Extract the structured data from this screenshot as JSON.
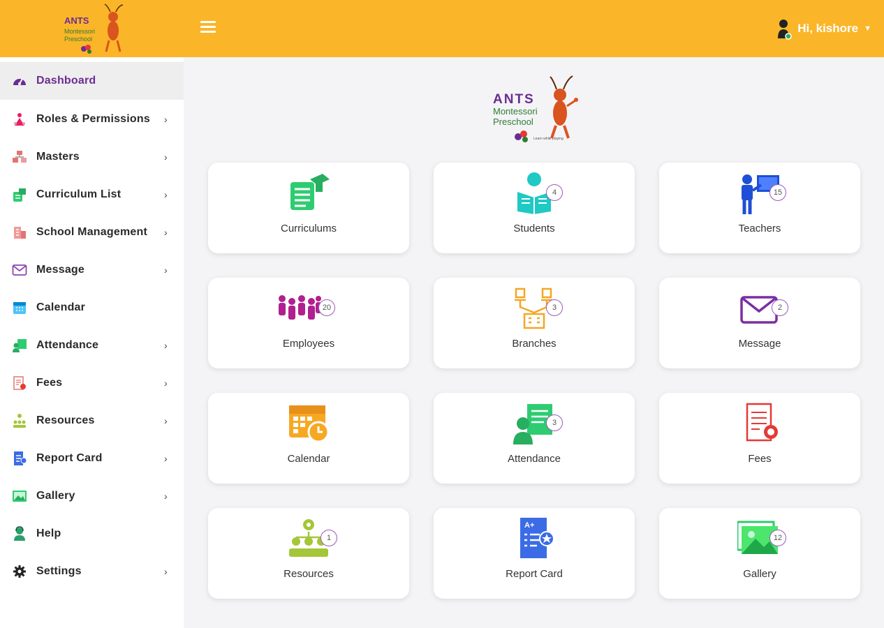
{
  "header": {
    "logo_text": {
      "line1": "ANTS",
      "line2": "Montessori",
      "line3": "Preschool",
      "tagline": "Learn while playing"
    },
    "menu_icon": "hamburger-icon",
    "user": {
      "greeting": "Hi, kishore",
      "icon": "user-icon",
      "caret": "▼"
    }
  },
  "colors": {
    "header": "#fbb528",
    "active_text": "#6a2d91",
    "badge_border": "#9b59b6"
  },
  "sidebar": {
    "items": [
      {
        "label": "Dashboard",
        "icon": "dashboard-icon",
        "chevron": ""
      },
      {
        "label": "Roles & Permissions",
        "icon": "roles-icon",
        "chevron": "›"
      },
      {
        "label": "Masters",
        "icon": "masters-icon",
        "chevron": "›"
      },
      {
        "label": "Curriculum List",
        "icon": "curriculum-icon",
        "chevron": "›"
      },
      {
        "label": "School Management",
        "icon": "school-icon",
        "chevron": "›"
      },
      {
        "label": "Message",
        "icon": "envelope-icon",
        "chevron": "›"
      },
      {
        "label": "Calendar",
        "icon": "calendar-icon",
        "chevron": ""
      },
      {
        "label": "Attendance",
        "icon": "attendance-icon",
        "chevron": "›"
      },
      {
        "label": "Fees",
        "icon": "fees-icon",
        "chevron": "›"
      },
      {
        "label": "Resources",
        "icon": "resources-icon",
        "chevron": "›"
      },
      {
        "label": "Report Card",
        "icon": "report-card-icon",
        "chevron": "›"
      },
      {
        "label": "Gallery",
        "icon": "gallery-icon",
        "chevron": "›"
      },
      {
        "label": "Help",
        "icon": "help-icon",
        "chevron": ""
      },
      {
        "label": "Settings",
        "icon": "gear-icon",
        "chevron": "›"
      }
    ]
  },
  "cards": [
    {
      "title": "Curriculums",
      "count": "",
      "icon": "curriculum-icon"
    },
    {
      "title": "Students",
      "count": "4",
      "icon": "student-icon"
    },
    {
      "title": "Teachers",
      "count": "15",
      "icon": "teacher-icon"
    },
    {
      "title": "Employees",
      "count": "20",
      "icon": "employees-icon"
    },
    {
      "title": "Branches",
      "count": "3",
      "icon": "branches-icon"
    },
    {
      "title": "Message",
      "count": "2",
      "icon": "envelope-icon"
    },
    {
      "title": "Calendar",
      "count": "",
      "icon": "calendar-icon"
    },
    {
      "title": "Attendance",
      "count": "3",
      "icon": "attendance-icon"
    },
    {
      "title": "Fees",
      "count": "",
      "icon": "fees-icon"
    },
    {
      "title": "Resources",
      "count": "1",
      "icon": "resources-icon"
    },
    {
      "title": "Report Card",
      "count": "",
      "icon": "report-card-icon"
    },
    {
      "title": "Gallery",
      "count": "12",
      "icon": "gallery-icon"
    }
  ]
}
